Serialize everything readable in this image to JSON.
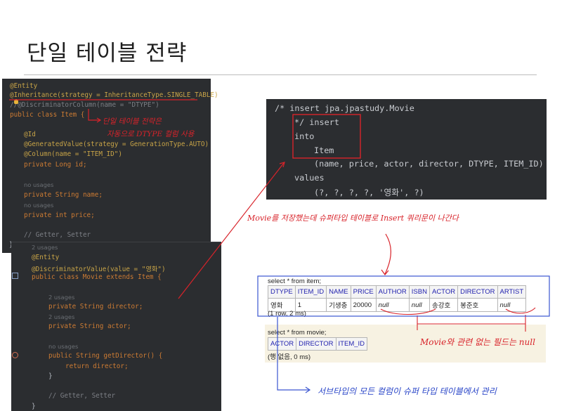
{
  "page": {
    "title": "단일 테이블 전략"
  },
  "item_code": {
    "lines": [
      "@Entity",
      "@Inheritance(strategy = InheritanceType.SINGLE_TABLE)",
      "//@DiscriminatorColumn(name = \"DTYPE\")",
      "public class Item {",
      "@Id",
      "@GeneratedValue(strategy = GenerationType.AUTO)",
      "@Column(name = \"ITEM_ID\")",
      "private Long id;",
      "no usages",
      "private String name;",
      "no usages",
      "private int price;",
      "// Getter, Setter",
      "}"
    ]
  },
  "movie_code": {
    "lines": [
      "2 usages",
      "@Entity",
      "@DiscriminatorValue(value = \"영화\")",
      "public class Movie extends Item {",
      "2 usages",
      "private String director;",
      "2 usages",
      "private String actor;",
      "no usages",
      "public String getDirector() {",
      "return director;",
      "}",
      "// Getter, Setter",
      "}"
    ]
  },
  "sql_log": {
    "lines": [
      "/* insert jpa.jpastudy.Movie",
      "*/ insert",
      "into",
      "Item",
      "(name, price, actor, director, DTYPE, ITEM_ID)",
      "values",
      "(?, ?, ?, ?, '영화', ?)"
    ]
  },
  "item_query": {
    "query": "select * from item;",
    "columns": [
      "DTYPE",
      "ITEM_ID",
      "NAME",
      "PRICE",
      "AUTHOR",
      "ISBN",
      "ACTOR",
      "DIRECTOR",
      "ARTIST"
    ],
    "rows": [
      [
        "영화",
        "1",
        "기생충",
        "20000",
        "null",
        "null",
        "송강호",
        "봉준호",
        "null"
      ]
    ],
    "footer": "(1 row, 2 ms)"
  },
  "movie_query": {
    "query": "select * from movie;",
    "columns": [
      "ACTOR",
      "DIRECTOR",
      "ITEM_ID"
    ],
    "footer": "(행 없음, 0 ms)"
  },
  "notes": {
    "dtype_note_1": "단일 테이블 전략은",
    "dtype_note_2": "자동으로 DTYPE 컬럼 사용",
    "insert_note": "Movie를 저장했는데 슈퍼타입 테이블로 Insert 쿼리문이 나간다",
    "null_note": "Movie와 관련 없는 필드는 null",
    "super_note": "서브타입의 모든 컬럼이 슈퍼 타입 테이블에서 관리"
  },
  "colors": {
    "editor_bg": "#2b2d30",
    "red_mark": "#d8232a",
    "blue_mark": "#3a55d0"
  }
}
